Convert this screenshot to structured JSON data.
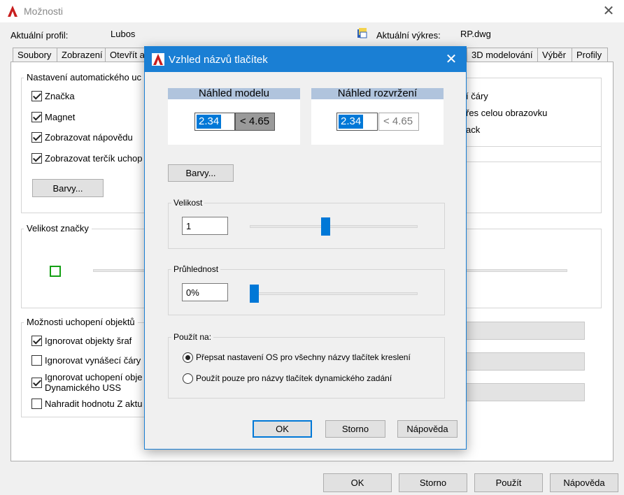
{
  "main": {
    "title": "Možnosti",
    "profile_label": "Aktuální profil:",
    "profile_value": "Lubos",
    "drawing_label": "Aktuální výkres:",
    "drawing_value": "RP.dwg",
    "tabs": [
      {
        "label": "Soubory"
      },
      {
        "label": "Zobrazení"
      },
      {
        "label": "Otevřít a"
      },
      {
        "label": "3D modelování"
      },
      {
        "label": "Výběr"
      },
      {
        "label": "Profily"
      }
    ],
    "autosnap_group": "Nastavení automatického uc",
    "autosnap_items": [
      {
        "label": "Značka",
        "checked": true
      },
      {
        "label": "Magnet",
        "checked": true
      },
      {
        "label": "Zobrazovat nápovědu",
        "checked": true
      },
      {
        "label": "Zobrazovat terčík uchop",
        "checked": true
      }
    ],
    "colors_button": "Barvy...",
    "right_items": [
      "í čáry",
      "řes celou obrazovku",
      "ack"
    ],
    "marker_size_group": "Velikost značky",
    "osnap_group": "Možnosti uchopení objektů",
    "osnap_items": [
      {
        "label": "Ignorovat objekty šraf",
        "checked": true
      },
      {
        "label": "Ignorovat vynášecí čáry",
        "checked": false
      },
      {
        "label": "Ignorovat uchopení obje",
        "label2": "Dynamického USS",
        "checked": true
      },
      {
        "label": "Nahradit hodnotu Z aktu",
        "checked": false
      }
    ],
    "footer": {
      "ok": "OK",
      "cancel": "Storno",
      "apply": "Použít",
      "help": "Nápověda"
    }
  },
  "dialog": {
    "title": "Vzhled názvů tlačítek",
    "model_preview": {
      "title": "Náhled modelu",
      "value": "2.34",
      "tip": "< 4.65"
    },
    "layout_preview": {
      "title": "Náhled rozvržení",
      "value": "2.34",
      "tip": "< 4.65"
    },
    "colors_button": "Barvy...",
    "size": {
      "label": "Velikost",
      "value": "1",
      "slider_fraction": 0.45
    },
    "transparency": {
      "label": "Průhlednost",
      "value": "0%",
      "slider_fraction": 0.0
    },
    "apply_to": {
      "label": "Použít na:",
      "options": [
        {
          "label": "Přepsat nastavení OS pro všechny názvy tlačítek kreslení",
          "selected": true
        },
        {
          "label": "Použít pouze pro názvy tlačítek dynamického zadání",
          "selected": false
        }
      ]
    },
    "buttons": {
      "ok": "OK",
      "cancel": "Storno",
      "help": "Nápověda"
    },
    "colors": {
      "accent": "#1a7fd4",
      "selection": "#0078d7",
      "tip_dark": "#9a9a9a"
    }
  }
}
